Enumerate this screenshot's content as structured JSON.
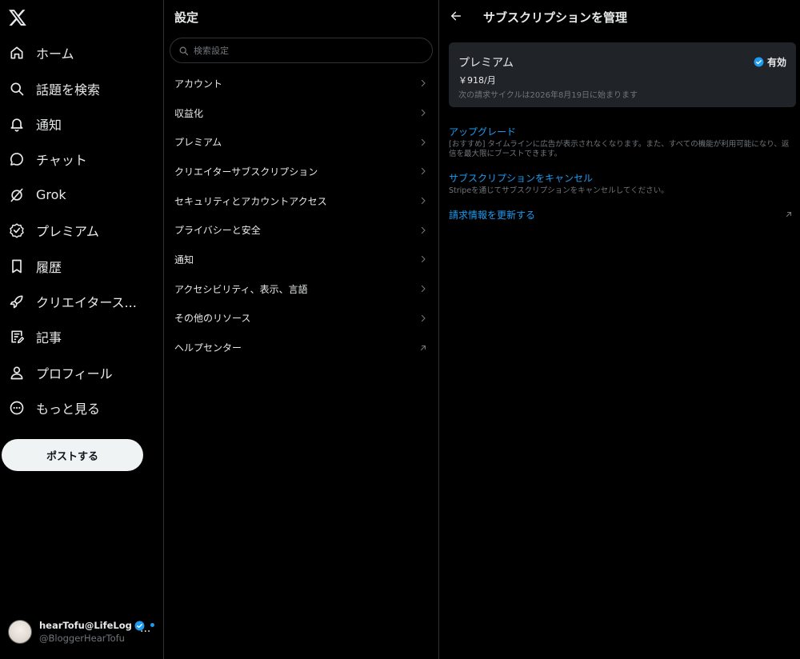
{
  "nav": {
    "items": [
      {
        "label": "ホーム",
        "icon": "home-icon"
      },
      {
        "label": "話題を検索",
        "icon": "search-icon"
      },
      {
        "label": "通知",
        "icon": "bell-icon"
      },
      {
        "label": "チャット",
        "icon": "chat-icon"
      },
      {
        "label": "Grok",
        "icon": "grok-icon"
      },
      {
        "label": "プレミアム",
        "icon": "premium-icon"
      },
      {
        "label": "履歴",
        "icon": "bookmark-icon"
      },
      {
        "label": "クリエイタース...",
        "icon": "rocket-icon"
      },
      {
        "label": "記事",
        "icon": "article-icon"
      },
      {
        "label": "プロフィール",
        "icon": "profile-icon"
      },
      {
        "label": "もっと見る",
        "icon": "more-circle-icon"
      }
    ],
    "post_button": "ポストする"
  },
  "account": {
    "name": "hearTofu@LifeLog",
    "handle": "@BloggerHearTofu",
    "more": "..."
  },
  "settings": {
    "title": "設定",
    "search_placeholder": "検索設定",
    "items": [
      {
        "label": "アカウント",
        "icon": "chevron-right-icon"
      },
      {
        "label": "収益化",
        "icon": "chevron-right-icon"
      },
      {
        "label": "プレミアム",
        "icon": "chevron-right-icon"
      },
      {
        "label": "クリエイターサブスクリプション",
        "icon": "chevron-right-icon"
      },
      {
        "label": "セキュリティとアカウントアクセス",
        "icon": "chevron-right-icon"
      },
      {
        "label": "プライバシーと安全",
        "icon": "chevron-right-icon"
      },
      {
        "label": "通知",
        "icon": "chevron-right-icon"
      },
      {
        "label": "アクセシビリティ、表示、言語",
        "icon": "chevron-right-icon"
      },
      {
        "label": "その他のリソース",
        "icon": "chevron-right-icon"
      },
      {
        "label": "ヘルプセンター",
        "icon": "external-link-icon"
      }
    ]
  },
  "subscription": {
    "title": "サブスクリプションを管理",
    "card": {
      "name": "プレミアム",
      "price": "￥918/月",
      "cycle": "次の請求サイクルは2026年8月19日に始まります",
      "status": "有効"
    },
    "actions": [
      {
        "title": "アップグレード",
        "desc": "[おすすめ] タイムラインに広告が表示されなくなります。また、すべての機能が利用可能になり、返信を最大限にブーストできます。"
      },
      {
        "title": "サブスクリプションをキャンセル",
        "desc": "Stripeを通じてサブスクリプションをキャンセルしてください。"
      },
      {
        "title": "請求情報を更新する",
        "desc": ""
      }
    ]
  },
  "colors": {
    "accent": "#1d9bf0",
    "background": "#000000",
    "card": "#202327",
    "border": "#2f3336",
    "muted_text": "#71767b"
  }
}
